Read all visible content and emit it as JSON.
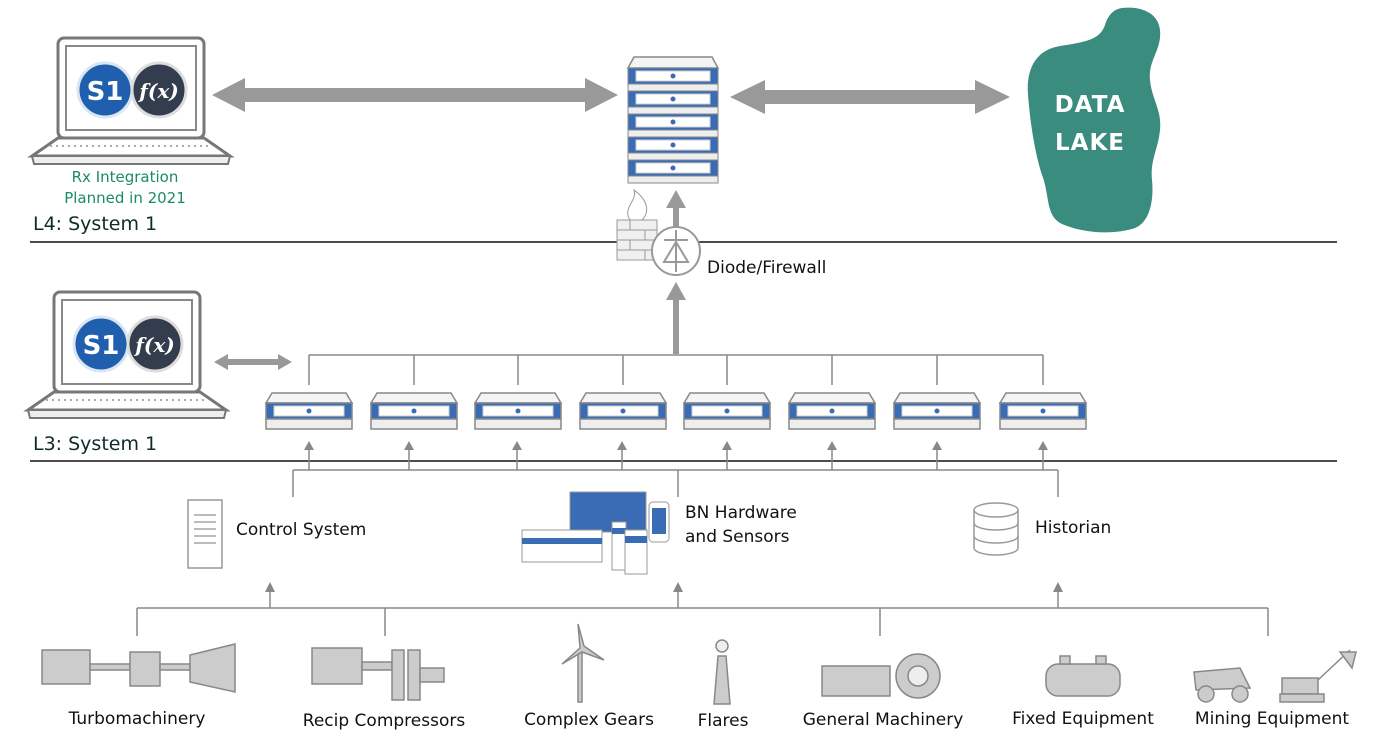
{
  "levels": {
    "l4": "L4: System 1",
    "l3": "L3: System 1"
  },
  "laptop_badges": {
    "s1": "S1",
    "fx": "f(x)"
  },
  "rx_note": [
    "Rx Integration",
    "Planned in 2021"
  ],
  "data_lake": [
    "DATA",
    "LAKE"
  ],
  "diode_label": "Diode/Firewall",
  "control_system": "Control System",
  "bn_hardware": [
    "BN Hardware",
    "and Sensors"
  ],
  "historian": "Historian",
  "equipment": [
    "Turbomachinery",
    "Recip Compressors",
    "Complex Gears",
    "Flares",
    "General Machinery",
    "Fixed Equipment",
    "Mining Equipment"
  ],
  "colors": {
    "server_blue": "#3a6bb5",
    "lake_green": "#3a8c7e",
    "arrow_gray": "#999999",
    "note_green": "#1b8a6b"
  }
}
